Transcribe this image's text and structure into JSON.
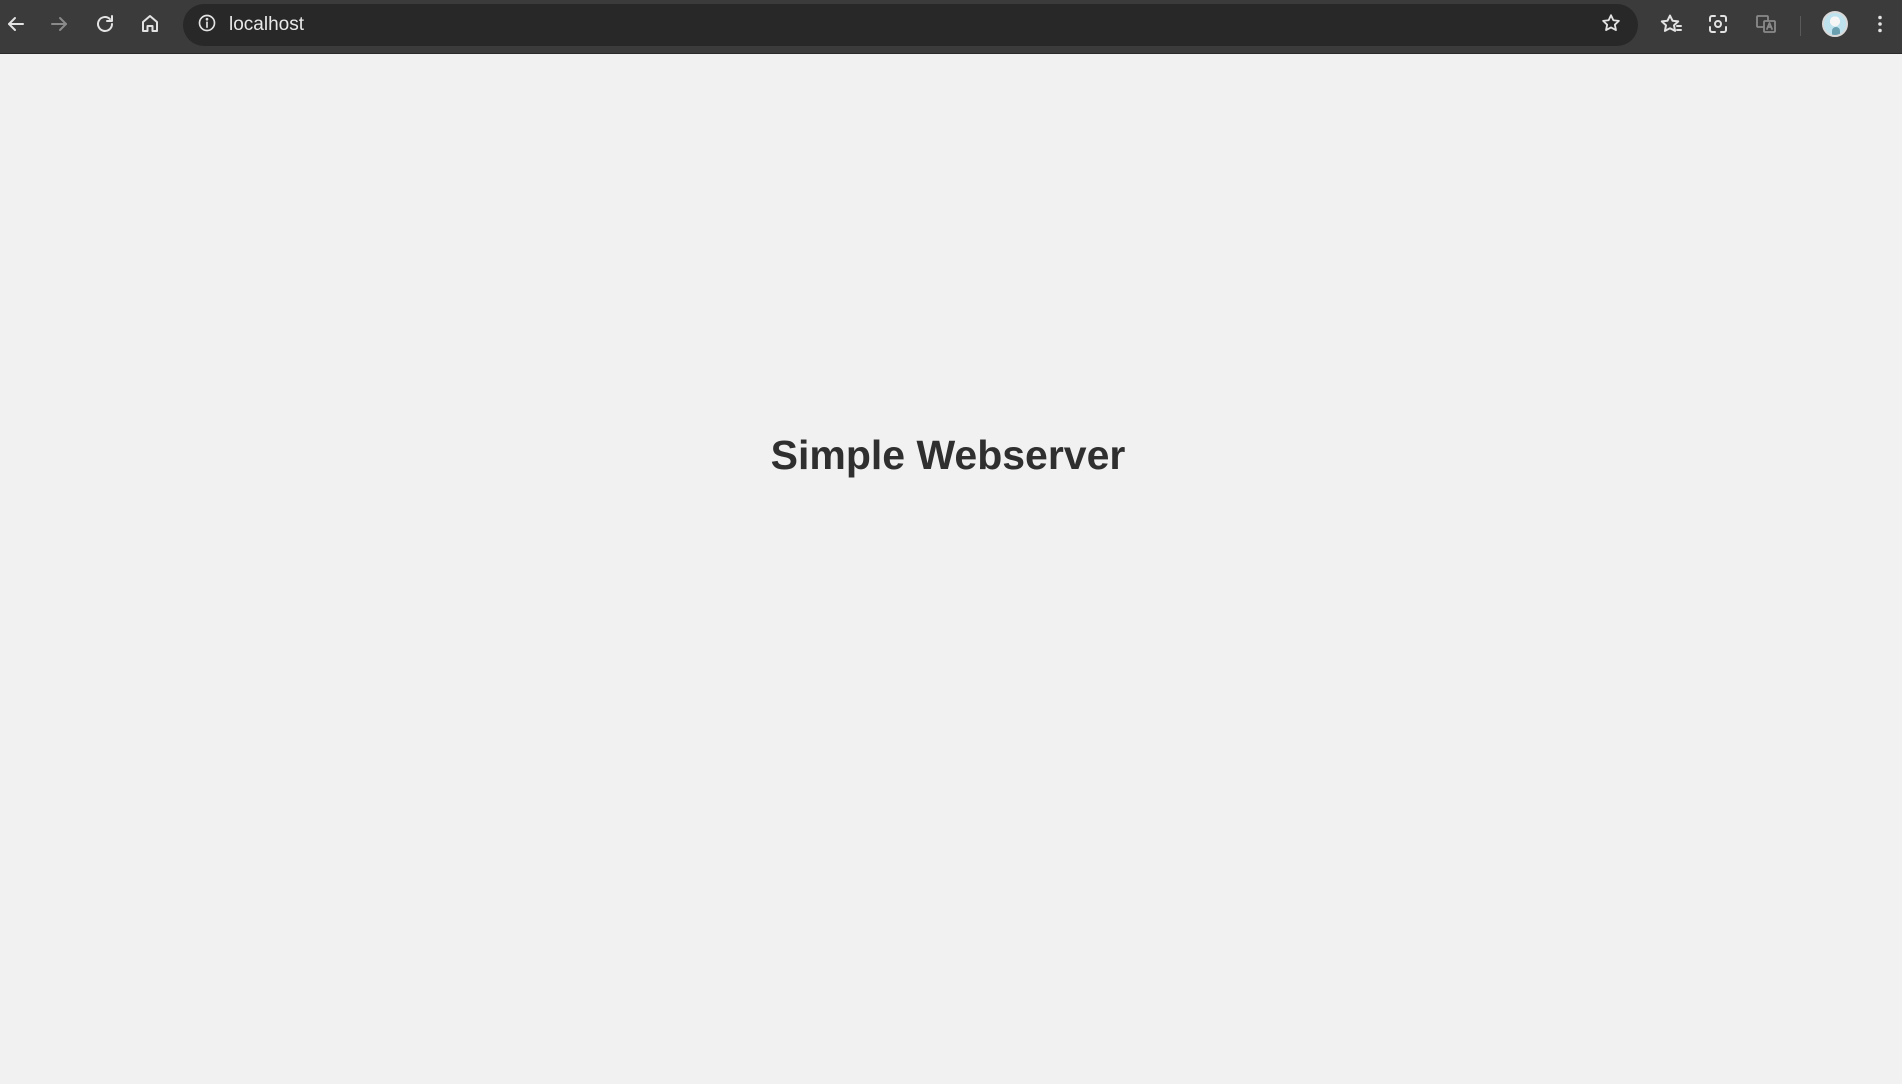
{
  "browser": {
    "address_bar": {
      "url": "localhost"
    },
    "icons": {
      "back": "back-arrow-icon",
      "forward": "forward-arrow-icon",
      "reload": "reload-icon",
      "home": "home-icon",
      "site_info": "info-icon",
      "bookmark": "star-icon",
      "bookmarks_manager": "star-list-icon",
      "screenshot": "screenshot-icon",
      "translate": "translate-icon",
      "profile": "avatar",
      "menu": "kebab-menu-icon"
    }
  },
  "page": {
    "title": "Simple Webserver",
    "background": "#f1f1f1",
    "text_color": "#2f2f2f"
  }
}
